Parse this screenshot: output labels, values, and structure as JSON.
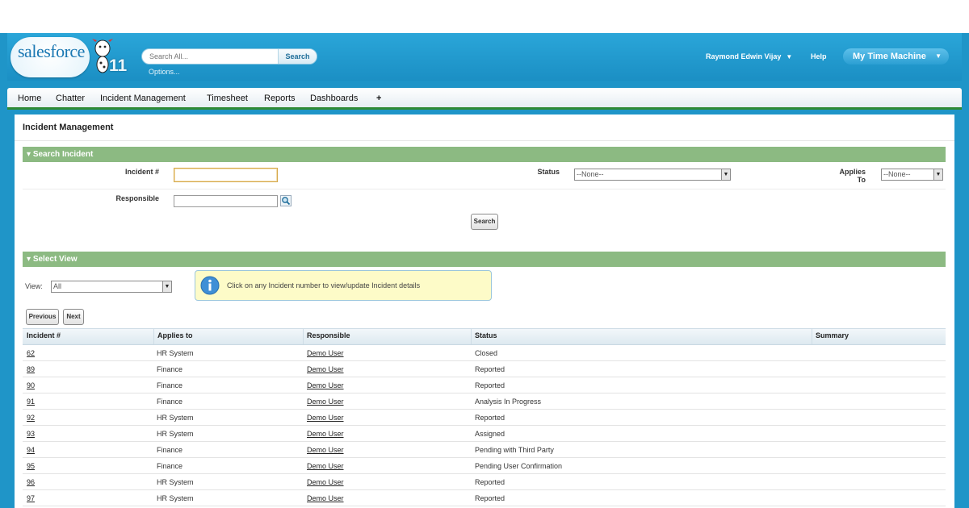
{
  "header": {
    "logo_text": "salesforce",
    "release_badge": "11",
    "search_placeholder": "Search All...",
    "search_button": "Search",
    "options_link": "Options...",
    "user_name": "Raymond Edwin Vijay",
    "help_link": "Help",
    "app_name": "My Time Machine"
  },
  "tabs": [
    "Home",
    "Chatter",
    "Incident Management",
    "Timesheet",
    "Reports",
    "Dashboards",
    "+"
  ],
  "page": {
    "title": "Incident Management"
  },
  "search_section": {
    "title": "Search Incident",
    "incident_label": "Incident #",
    "responsible_label": "Responsible",
    "status_label": "Status",
    "status_value": "--None--",
    "applies_label_line1": "Applies",
    "applies_label_line2": "To",
    "applies_value": "--None--",
    "search_button": "Search"
  },
  "view_section": {
    "title": "Select View",
    "view_label": "View:",
    "view_value": "All",
    "info_message": "Click on any Incident number to view/update Incident details",
    "previous_button": "Previous",
    "next_button": "Next"
  },
  "table": {
    "columns": [
      "Incident #",
      "Applies to",
      "Responsible",
      "Status",
      "Summary"
    ],
    "rows": [
      {
        "id": "62",
        "applies": "HR System",
        "responsible": "Demo User",
        "status": "Closed",
        "summary": ""
      },
      {
        "id": "89",
        "applies": "Finance",
        "responsible": "Demo User",
        "status": "Reported",
        "summary": ""
      },
      {
        "id": "90",
        "applies": "Finance",
        "responsible": "Demo User",
        "status": "Reported",
        "summary": ""
      },
      {
        "id": "91",
        "applies": "Finance",
        "responsible": "Demo User",
        "status": "Analysis In Progress",
        "summary": ""
      },
      {
        "id": "92",
        "applies": "HR System",
        "responsible": "Demo User",
        "status": "Reported",
        "summary": ""
      },
      {
        "id": "93",
        "applies": "HR System",
        "responsible": "Demo User",
        "status": "Assigned",
        "summary": ""
      },
      {
        "id": "94",
        "applies": "Finance",
        "responsible": "Demo User",
        "status": "Pending with Third Party",
        "summary": ""
      },
      {
        "id": "95",
        "applies": "Finance",
        "responsible": "Demo User",
        "status": "Pending User Confirmation",
        "summary": ""
      },
      {
        "id": "96",
        "applies": "HR System",
        "responsible": "Demo User",
        "status": "Reported",
        "summary": ""
      },
      {
        "id": "97",
        "applies": "HR System",
        "responsible": "Demo User",
        "status": "Reported",
        "summary": ""
      }
    ]
  },
  "colors": {
    "header_blue": "#1f95c8",
    "section_green": "#8cba82",
    "tab_underline": "#2f8a35",
    "info_yellow": "#fdfbc8"
  },
  "icons": {
    "search_lookup": "magnifier-icon",
    "info": "info-icon",
    "mascot": "mascot-icon"
  }
}
